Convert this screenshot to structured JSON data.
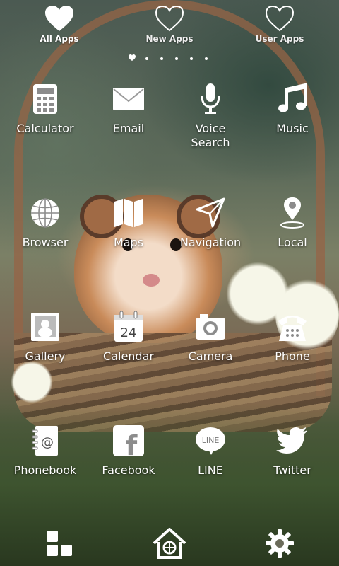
{
  "tabs": [
    {
      "label": "All Apps",
      "active": true
    },
    {
      "label": "New Apps",
      "active": false
    },
    {
      "label": "User Apps",
      "active": false
    }
  ],
  "page_indicator": {
    "count": 6,
    "current": 1
  },
  "apps": [
    {
      "label": "Calculator",
      "icon": "calculator-icon"
    },
    {
      "label": "Email",
      "icon": "envelope-icon"
    },
    {
      "label": "Voice\nSearch",
      "icon": "microphone-icon"
    },
    {
      "label": "Music",
      "icon": "music-note-icon"
    },
    {
      "label": "Browser",
      "icon": "globe-icon"
    },
    {
      "label": "Maps",
      "icon": "map-icon"
    },
    {
      "label": "Navigation",
      "icon": "navigation-arrow-icon"
    },
    {
      "label": "Local",
      "icon": "location-pin-icon"
    },
    {
      "label": "Gallery",
      "icon": "photo-frame-icon"
    },
    {
      "label": "Calendar",
      "icon": "calendar-icon",
      "text": "24"
    },
    {
      "label": "Camera",
      "icon": "camera-icon"
    },
    {
      "label": "Phone",
      "icon": "telephone-icon"
    },
    {
      "label": "Phonebook",
      "icon": "address-book-icon",
      "text": "@"
    },
    {
      "label": "Facebook",
      "icon": "facebook-icon",
      "text": "f"
    },
    {
      "label": "LINE",
      "icon": "line-icon",
      "text": "LINE"
    },
    {
      "label": "Twitter",
      "icon": "twitter-bird-icon"
    }
  ],
  "dock": [
    {
      "icon": "apps-grid-icon"
    },
    {
      "icon": "home-icon"
    },
    {
      "icon": "settings-gear-icon"
    }
  ]
}
